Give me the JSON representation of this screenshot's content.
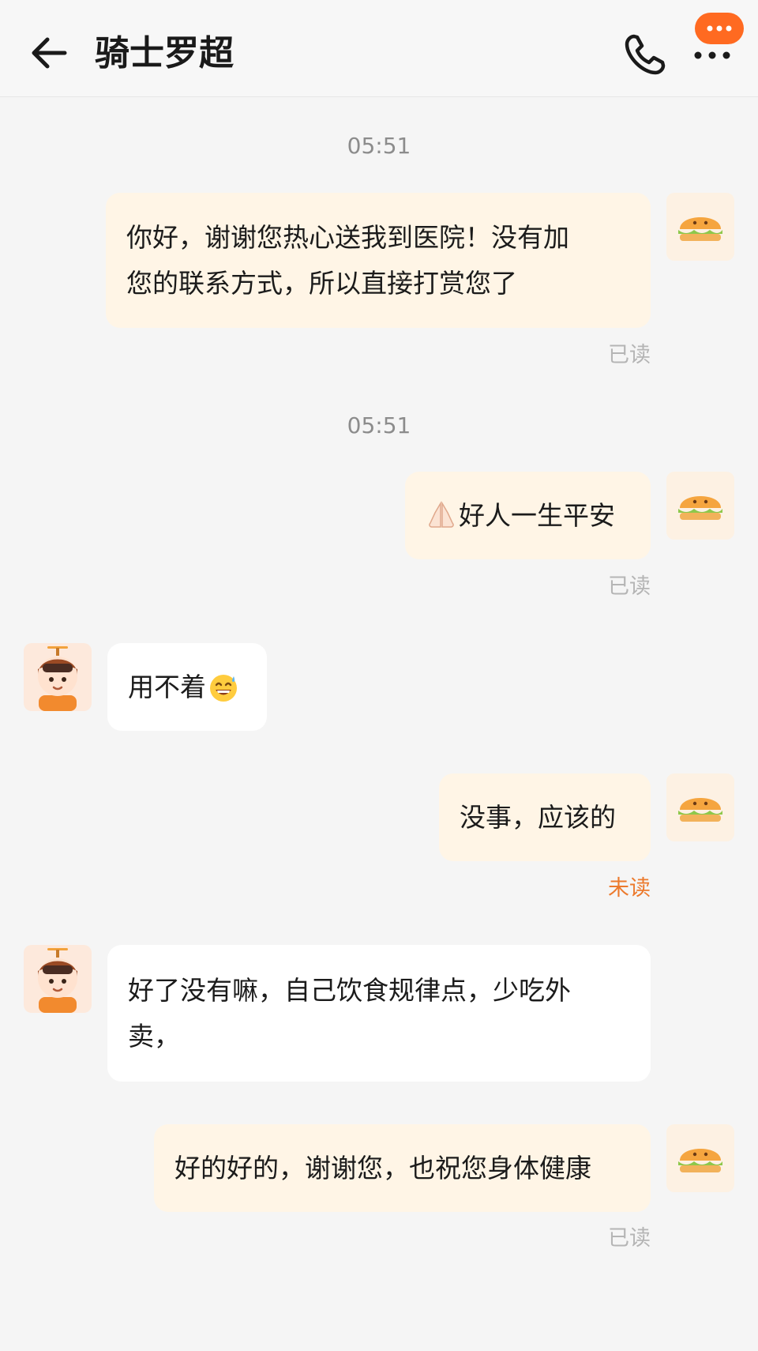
{
  "header": {
    "title": "骑士罗超",
    "back_icon": "arrow-left-icon",
    "phone_icon": "phone-icon",
    "more_icon": "more-dots-icon",
    "badge_icon": "chat-bubble-dots-icon",
    "accent_color": "#ff6a21"
  },
  "messages": [
    {
      "type": "timestamp",
      "text": "05:51"
    },
    {
      "type": "message",
      "sender": "me",
      "text": "你好，谢谢您热心送我到医院！没有加\n您的联系方式，所以直接打赏您了",
      "status": "已读"
    },
    {
      "type": "timestamp",
      "text": "05:51"
    },
    {
      "type": "message",
      "sender": "me",
      "emoji_icon": "pray-hands-icon",
      "text": "好人一生平安",
      "status": "已读"
    },
    {
      "type": "message",
      "sender": "rider",
      "text": "用不着",
      "emoji_icon": "grinning-sweat-icon"
    },
    {
      "type": "message",
      "sender": "me",
      "text": "没事，应该的",
      "status": "未读"
    },
    {
      "type": "message",
      "sender": "rider",
      "text": "好了没有嘛，自己饮食规律点，少吃外\n卖，"
    },
    {
      "type": "message",
      "sender": "me",
      "text": "好的好的，谢谢您，也祝您身体健康",
      "status": "已读"
    }
  ],
  "avatars": {
    "me": "burger-avatar-icon",
    "rider": "rider-avatar-icon"
  },
  "colors": {
    "my_bubble": "#fff5e6",
    "their_bubble": "#ffffff",
    "read": "#b5b5b5",
    "unread": "#ec7a2d"
  }
}
